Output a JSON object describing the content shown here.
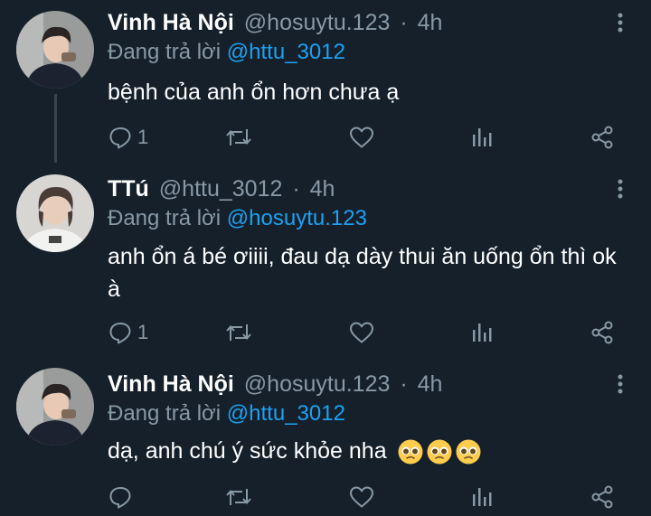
{
  "colors": {
    "background": "#15202b",
    "text": "#ffffff",
    "secondary": "#8899a6",
    "mention": "#1da1f2",
    "thread_line": "#38444d"
  },
  "tweets": [
    {
      "name": "Vinh Hà Nội",
      "handle": "@hosuytu.123",
      "dot": "·",
      "time": "4h",
      "replying_prefix": "Đang trả lời",
      "replying_to": "@httu_3012",
      "text": "bệnh của anh ổn hơn chưa ạ",
      "reply_count": "1",
      "icons": [
        "more-vertical-icon",
        "reply-icon",
        "retweet-icon",
        "like-icon",
        "analytics-icon",
        "share-icon"
      ]
    },
    {
      "name": "TTú",
      "handle": "@httu_3012",
      "dot": "·",
      "time": "4h",
      "replying_prefix": "Đang trả lời",
      "replying_to": "@hosuytu.123",
      "text": "anh ổn á bé ơiiii, đau dạ dày thui ăn uống ổn thì ok à",
      "reply_count": "1",
      "icons": [
        "more-vertical-icon",
        "reply-icon",
        "retweet-icon",
        "like-icon",
        "analytics-icon",
        "share-icon"
      ]
    },
    {
      "name": "Vinh Hà Nội",
      "handle": "@hosuytu.123",
      "dot": "·",
      "time": "4h",
      "replying_prefix": "Đang trả lời",
      "replying_to": "@httu_3012",
      "text": "dạ, anh chú ý sức khỏe nha",
      "emojis": [
        "pleading-face-icon",
        "pleading-face-icon",
        "pleading-face-icon"
      ],
      "reply_count": "",
      "icons": [
        "more-vertical-icon",
        "reply-icon",
        "retweet-icon",
        "like-icon",
        "analytics-icon",
        "share-icon"
      ]
    }
  ]
}
